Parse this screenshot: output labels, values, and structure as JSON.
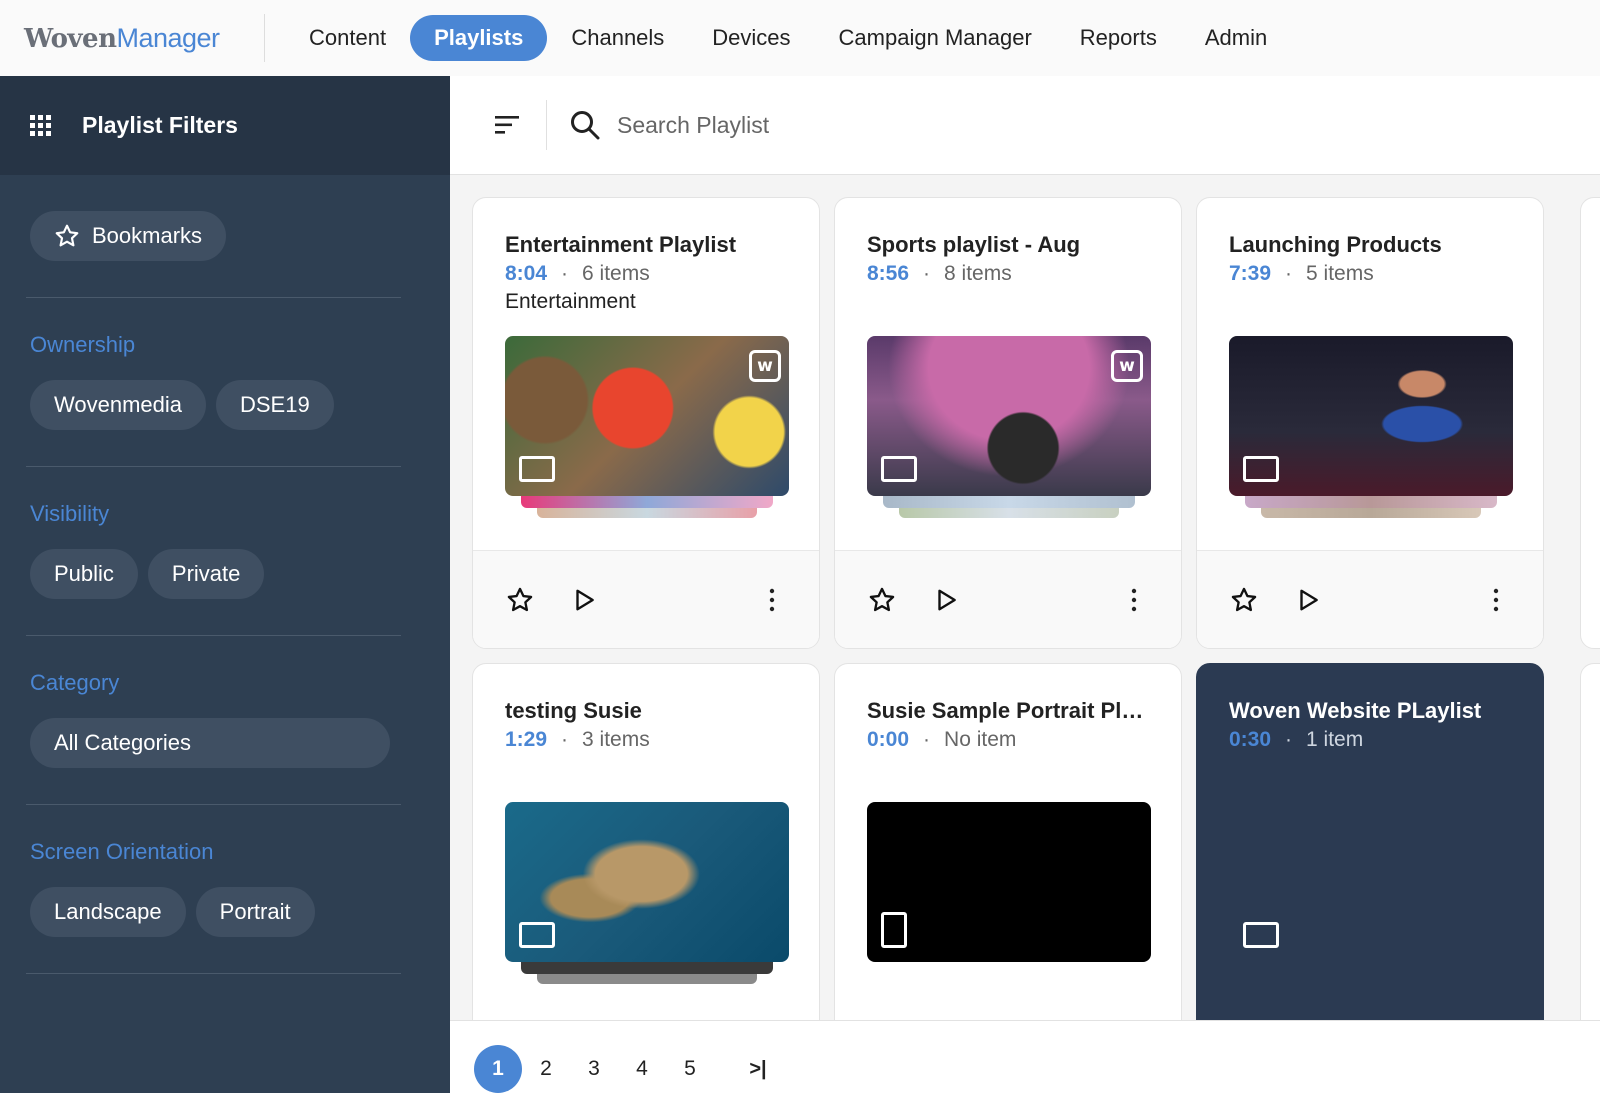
{
  "app": {
    "logo_part1": "Woven",
    "logo_part2": "Manager"
  },
  "nav": [
    {
      "label": "Content",
      "active": false
    },
    {
      "label": "Playlists",
      "active": true
    },
    {
      "label": "Channels",
      "active": false
    },
    {
      "label": "Devices",
      "active": false
    },
    {
      "label": "Campaign Manager",
      "active": false
    },
    {
      "label": "Reports",
      "active": false
    },
    {
      "label": "Admin",
      "active": false
    }
  ],
  "sidebar": {
    "title": "Playlist Filters",
    "bookmarks_label": "Bookmarks",
    "sections": [
      {
        "label": "Ownership",
        "chips": [
          "Wovenmedia",
          "DSE19"
        ]
      },
      {
        "label": "Visibility",
        "chips": [
          "Public",
          "Private"
        ]
      },
      {
        "label": "Category",
        "chips": [
          "All Categories"
        ]
      },
      {
        "label": "Screen Orientation",
        "chips": [
          "Landscape",
          "Portrait"
        ]
      }
    ]
  },
  "search": {
    "placeholder": "Search Playlist"
  },
  "playlists": [
    {
      "title": "Entertainment Playlist",
      "duration": "8:04",
      "items": "6 items",
      "category": "Entertainment",
      "orientation": "landscape",
      "badge": "w"
    },
    {
      "title": "Sports playlist - Aug",
      "duration": "8:56",
      "items": "8 items",
      "category": "",
      "orientation": "landscape",
      "badge": "w"
    },
    {
      "title": "Launching Products",
      "duration": "7:39",
      "items": "5 items",
      "category": "",
      "orientation": "landscape",
      "badge": ""
    },
    {
      "title": "testing Susie",
      "duration": "1:29",
      "items": "3 items",
      "category": "",
      "orientation": "landscape",
      "badge": ""
    },
    {
      "title": "Susie Sample Portrait Playli…",
      "duration": "0:00",
      "items": "No item",
      "category": "",
      "orientation": "portrait",
      "badge": ""
    },
    {
      "title": "Woven Website PLaylist",
      "duration": "0:30",
      "items": "1 item",
      "category": "",
      "orientation": "landscape",
      "badge": ""
    }
  ],
  "pagination": {
    "pages": [
      "1",
      "2",
      "3",
      "4",
      "5"
    ],
    "current": "1",
    "last_label": ">|"
  },
  "colors": {
    "accent": "#4a86d4",
    "sidebar": "#2e3f52",
    "sidebar_header": "#263445",
    "chip": "#3f4f62",
    "dark_card": "#2b3a52"
  }
}
